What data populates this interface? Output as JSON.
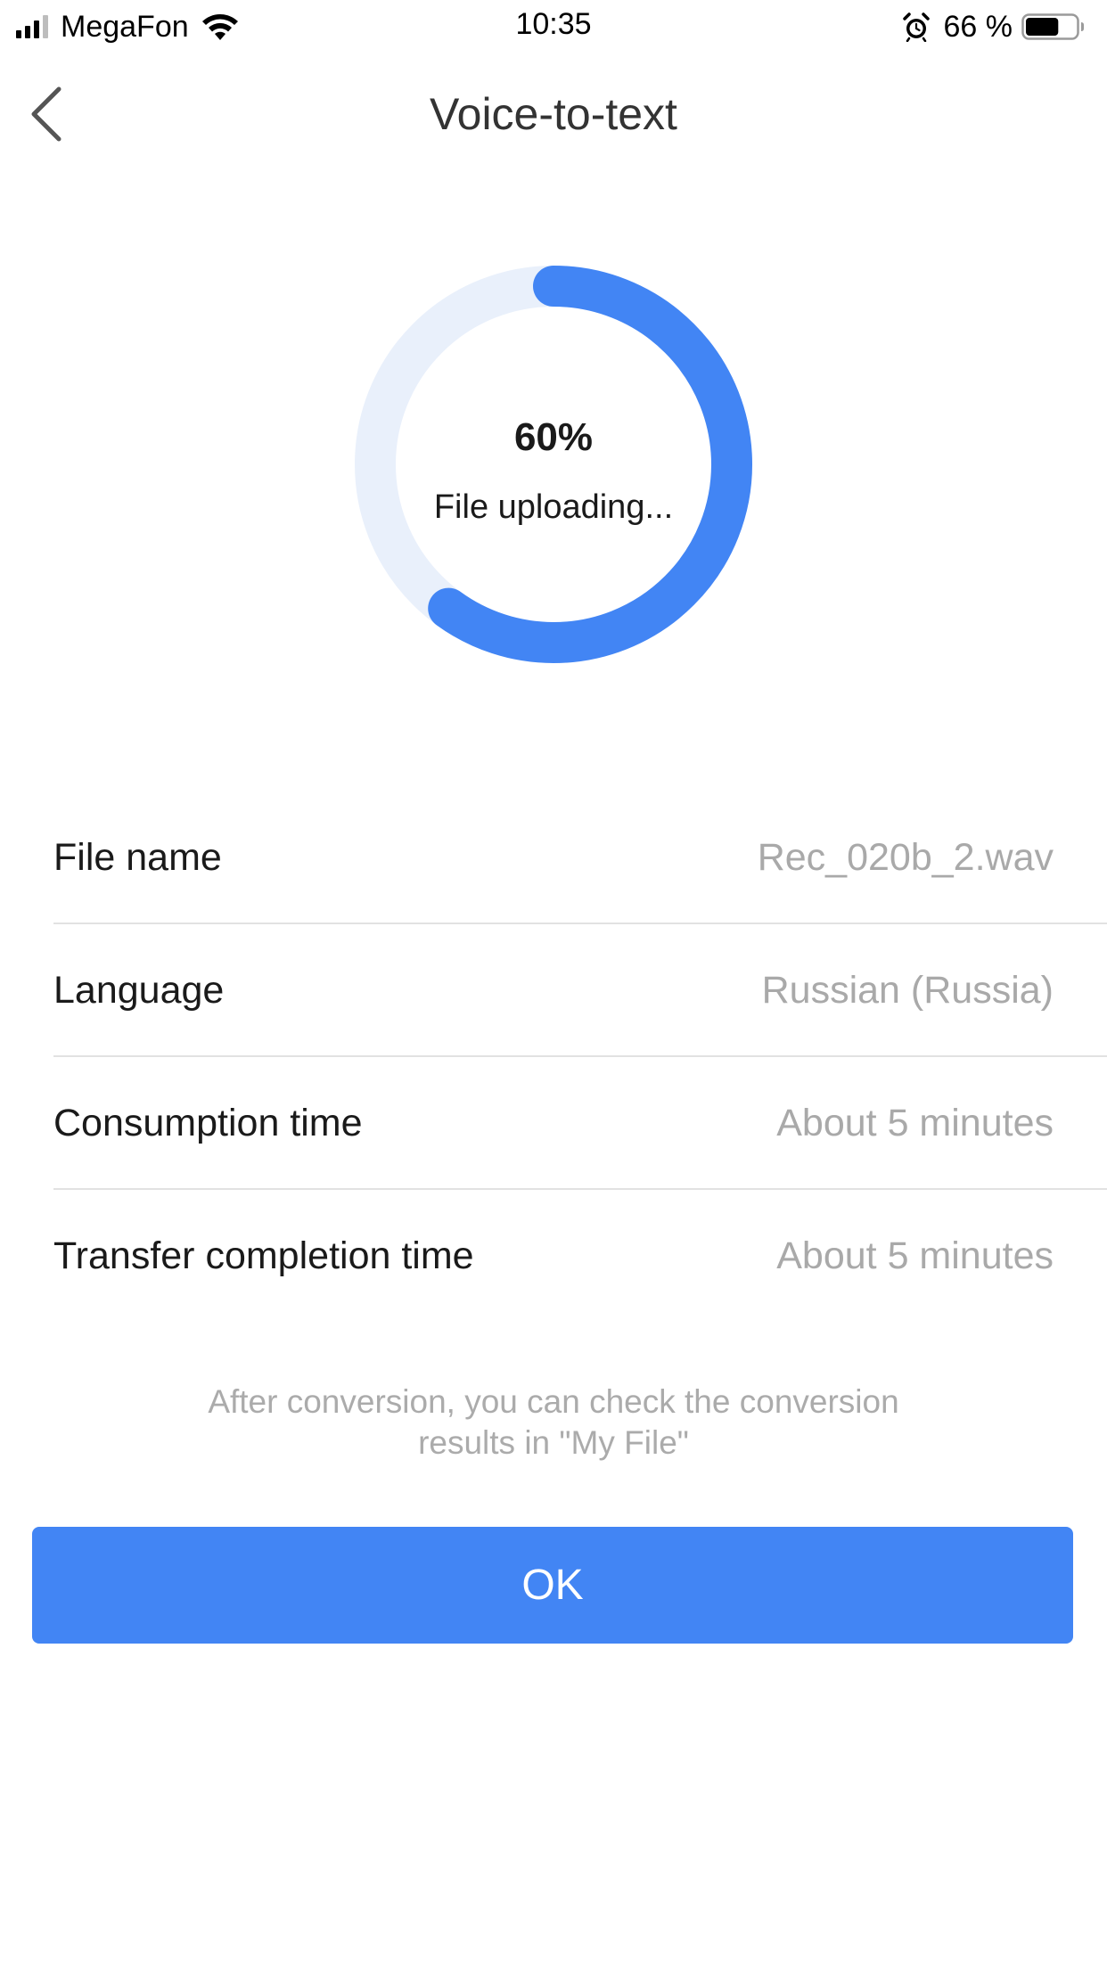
{
  "status_bar": {
    "carrier": "MegaFon",
    "time": "10:35",
    "battery_percent": "66 %",
    "battery_level": 0.66,
    "signal_bars": 3,
    "icons": [
      "signal-icon",
      "wifi-icon",
      "alarm-icon",
      "battery-icon"
    ]
  },
  "nav": {
    "title": "Voice-to-text",
    "back_icon": "chevron-left-icon"
  },
  "progress": {
    "percent_text": "60%",
    "fraction": 0.6,
    "status": "File uploading...",
    "colors": {
      "track": "#e9f0fb",
      "fill": "#4285f4"
    }
  },
  "info": [
    {
      "label": "File name",
      "value": "Rec_020b_2.wav"
    },
    {
      "label": "Language",
      "value": "Russian (Russia)"
    },
    {
      "label": "Consumption time",
      "value": "About 5 minutes"
    },
    {
      "label": "Transfer completion time",
      "value": "About 5 minutes"
    }
  ],
  "hint": {
    "line1": "After conversion, you can check the conversion",
    "line2": "results in \"My File\""
  },
  "ok_button": {
    "label": "OK",
    "color": "#4285f4"
  }
}
